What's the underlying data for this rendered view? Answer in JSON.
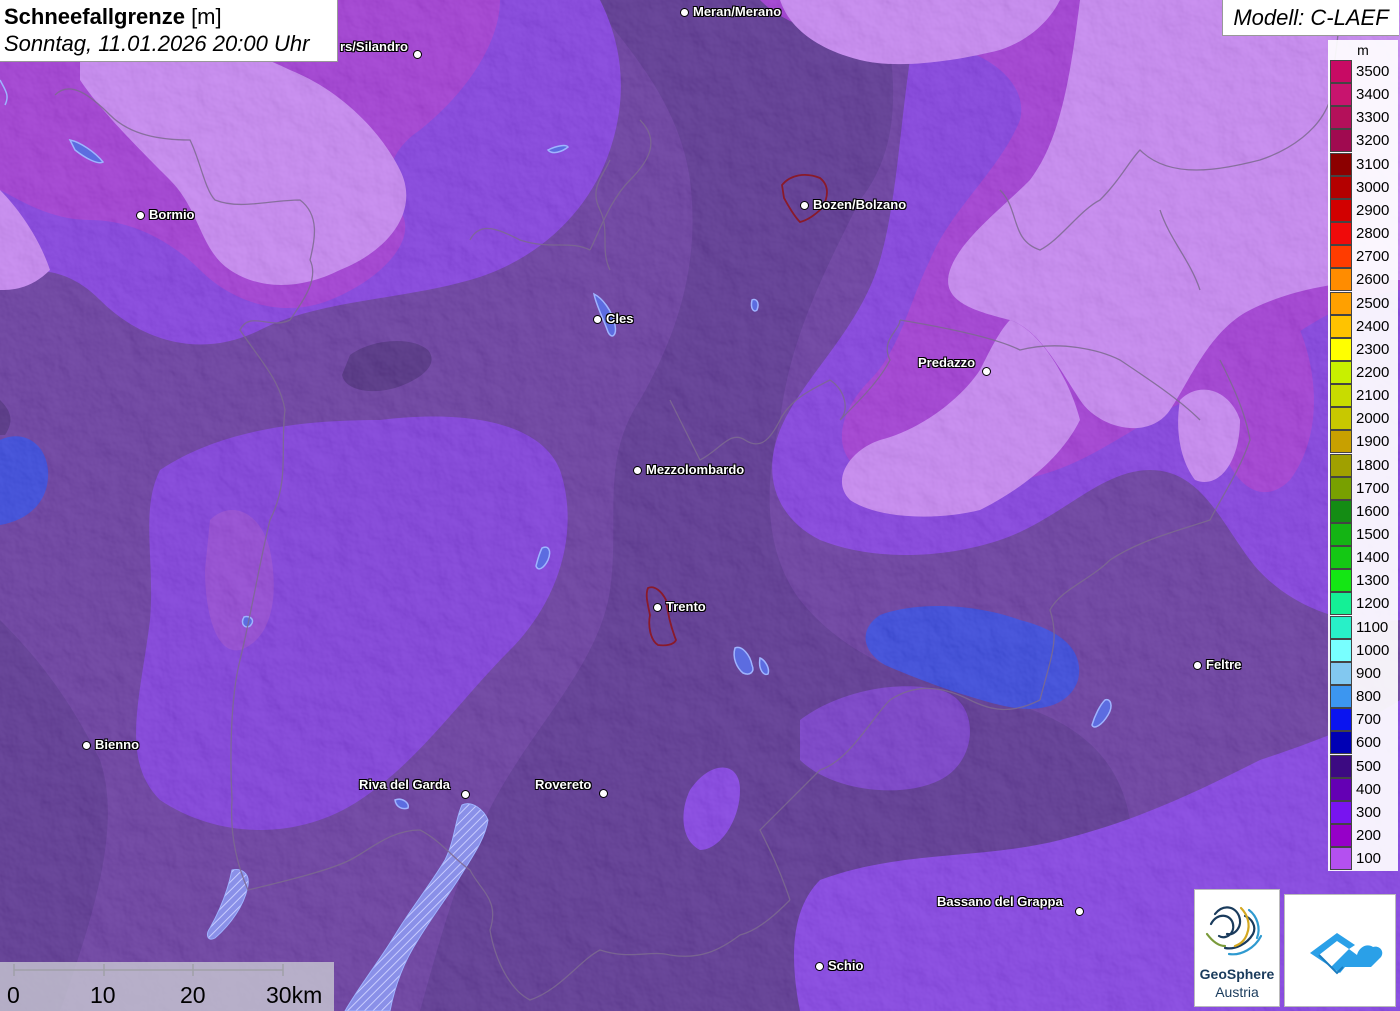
{
  "header": {
    "title_bold": "Schneefallgrenze",
    "title_unit": " [m]",
    "datetime": "Sonntag, 11.01.2026 20:00 Uhr"
  },
  "model": {
    "label": "Modell: C-LAEF"
  },
  "legend": {
    "unit": "m",
    "items": [
      {
        "label": "3500",
        "color": "#c80a64"
      },
      {
        "label": "3400",
        "color": "#c8146e"
      },
      {
        "label": "3300",
        "color": "#b4105a"
      },
      {
        "label": "3200",
        "color": "#a00a50"
      },
      {
        "label": "3100",
        "color": "#8c0000"
      },
      {
        "label": "3000",
        "color": "#b40000"
      },
      {
        "label": "2900",
        "color": "#d20000"
      },
      {
        "label": "2800",
        "color": "#f00a0a"
      },
      {
        "label": "2700",
        "color": "#ff3c00"
      },
      {
        "label": "2600",
        "color": "#ff8c00"
      },
      {
        "label": "2500",
        "color": "#ffa000"
      },
      {
        "label": "2400",
        "color": "#ffc300"
      },
      {
        "label": "2300",
        "color": "#ffff00"
      },
      {
        "label": "2200",
        "color": "#c8f000"
      },
      {
        "label": "2100",
        "color": "#c8dc00"
      },
      {
        "label": "2000",
        "color": "#c8c800"
      },
      {
        "label": "1900",
        "color": "#c8a000"
      },
      {
        "label": "1800",
        "color": "#a0a000"
      },
      {
        "label": "1700",
        "color": "#78a000"
      },
      {
        "label": "1600",
        "color": "#148c14"
      },
      {
        "label": "1500",
        "color": "#14b414"
      },
      {
        "label": "1400",
        "color": "#14c814"
      },
      {
        "label": "1300",
        "color": "#14e614"
      },
      {
        "label": "1200",
        "color": "#14f096"
      },
      {
        "label": "1100",
        "color": "#28f0c8"
      },
      {
        "label": "1000",
        "color": "#78ffff"
      },
      {
        "label": "900",
        "color": "#82c8f0"
      },
      {
        "label": "800",
        "color": "#3c96f0"
      },
      {
        "label": "700",
        "color": "#0a14f0"
      },
      {
        "label": "600",
        "color": "#0000b4"
      },
      {
        "label": "500",
        "color": "#3c0a82"
      },
      {
        "label": "400",
        "color": "#6400b4"
      },
      {
        "label": "300",
        "color": "#7814f0"
      },
      {
        "label": "200",
        "color": "#9600c8"
      },
      {
        "label": "100",
        "color": "#b450f0"
      }
    ]
  },
  "cities": [
    {
      "name": "Meran/Merano"
    },
    {
      "name": "rs/Silandro"
    },
    {
      "name": "Bormio"
    },
    {
      "name": "Bozen/Bolzano"
    },
    {
      "name": "Cles"
    },
    {
      "name": "Predazzo"
    },
    {
      "name": "Mezzolombardo"
    },
    {
      "name": "Trento"
    },
    {
      "name": "Feltre"
    },
    {
      "name": "Bienno"
    },
    {
      "name": "Riva del Garda"
    },
    {
      "name": "Rovereto"
    },
    {
      "name": "Bassano del Grappa"
    },
    {
      "name": "Schio"
    }
  ],
  "scale": {
    "labels": [
      "0",
      "10",
      "20",
      "30km"
    ]
  },
  "logos": {
    "geosphere_name": "GeoSphere",
    "geosphere_sub": "Austria",
    "app_icon": "mountain-cloud-icon"
  }
}
